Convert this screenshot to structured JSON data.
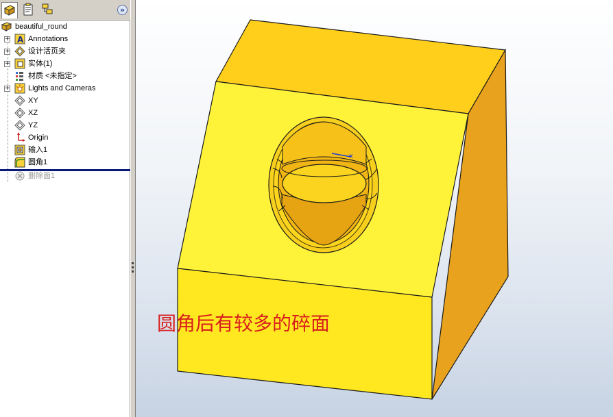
{
  "sidebar": {
    "tabs": [
      {
        "icon": "feature-manager-icon"
      },
      {
        "icon": "property-manager-icon"
      },
      {
        "icon": "configuration-manager-icon"
      }
    ],
    "expand_icon": "double-chevron-right-icon",
    "expand_label": "»",
    "tree": {
      "root": {
        "label": "beautiful_round",
        "icon": "part-icon"
      },
      "items": [
        {
          "label": "Annotations",
          "icon": "annotations-icon",
          "expandable": true
        },
        {
          "label": "设计活页夹",
          "icon": "design-binder-icon",
          "expandable": true
        },
        {
          "label": "实体(1)",
          "icon": "solid-bodies-icon",
          "expandable": true
        },
        {
          "label": "材质 <未指定>",
          "icon": "material-icon",
          "expandable": false
        },
        {
          "label": "Lights and Cameras",
          "icon": "lights-cameras-icon",
          "expandable": true
        },
        {
          "label": "XY",
          "icon": "plane-icon",
          "expandable": false
        },
        {
          "label": "XZ",
          "icon": "plane-icon",
          "expandable": false
        },
        {
          "label": "YZ",
          "icon": "plane-icon",
          "expandable": false
        },
        {
          "label": "Origin",
          "icon": "origin-icon",
          "expandable": false
        },
        {
          "label": "输入1",
          "icon": "imported-body-icon",
          "expandable": false
        },
        {
          "label": "圆角1",
          "icon": "fillet-icon",
          "expandable": false
        },
        {
          "label": "删除面1",
          "icon": "delete-face-icon",
          "expandable": false,
          "suppressed": true
        }
      ]
    }
  },
  "viewport": {
    "caption": "圆角后有较多的碎面",
    "colors": {
      "part_front": "#fff33a",
      "part_side": "#e9a21d",
      "part_top": "#ffcf1b",
      "edge": "#1a1a1a",
      "caption": "#d81e1e",
      "rollback_bar": "#0a1a7a"
    }
  }
}
